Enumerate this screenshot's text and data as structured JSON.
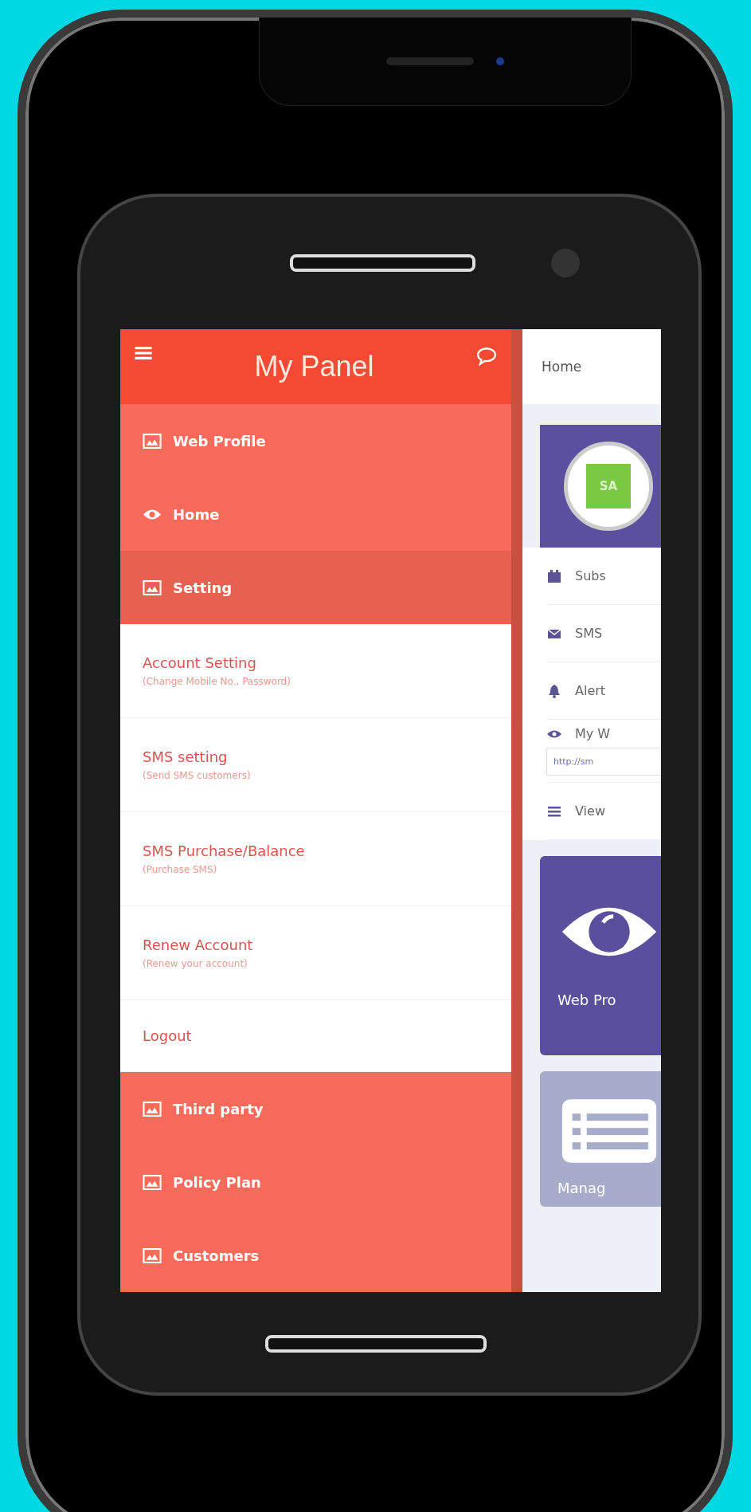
{
  "drawer": {
    "title": "My Panel",
    "items": [
      {
        "label": "Web Profile",
        "kind": "group",
        "expanded": false
      },
      {
        "label": "Home",
        "kind": "link",
        "expanded": false
      },
      {
        "label": "Setting",
        "kind": "group",
        "expanded": true,
        "children": [
          {
            "title": "Account Setting",
            "subtitle": "(Change Mobile No., Password)"
          },
          {
            "title": "SMS setting",
            "subtitle": "(Send SMS customers)"
          },
          {
            "title": "SMS Purchase/Balance",
            "subtitle": "(Purchase SMS)"
          },
          {
            "title": "Renew Account",
            "subtitle": "(Renew your account)"
          },
          {
            "title": "Logout"
          }
        ]
      },
      {
        "label": "Third party",
        "kind": "group",
        "expanded": false
      },
      {
        "label": "Policy Plan",
        "kind": "group",
        "expanded": false
      },
      {
        "label": "Customers",
        "kind": "group",
        "expanded": false
      }
    ]
  },
  "content": {
    "breadcrumb": "Home",
    "profile": {
      "initials": "SA"
    },
    "rows": [
      {
        "label": "Subs"
      },
      {
        "label": "SMS"
      },
      {
        "label": "Alert"
      },
      {
        "label": "My W",
        "url": "http://sm"
      },
      {
        "label": "View"
      }
    ],
    "tiles": [
      {
        "label": "Web Pro",
        "color": "#5a4f9c"
      },
      {
        "label": "Manag",
        "color": "#a7acca"
      }
    ]
  }
}
